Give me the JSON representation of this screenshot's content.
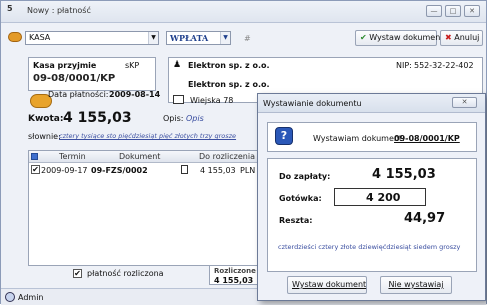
{
  "window": {
    "title": "Nowy : płatność",
    "app_glyph": "5",
    "controls": [
      "minimize-icon",
      "maximize-icon",
      "close-icon"
    ]
  },
  "toolbar": {
    "register_combo": "KASA",
    "type_combo": "WPŁATA",
    "hash": "#",
    "issue_document_label": "Wystaw dokument",
    "cancel_label": "Anuluj"
  },
  "receipt": {
    "kind_label": "Kasa przyjmie",
    "doc_type": "sKP",
    "number": "09-08/0001/KP",
    "payment_date_label": "Data płatności:",
    "payment_date": "2009-08-14",
    "amount_label": "Kwota:",
    "amount": "4 155,03",
    "in_words_label": "słownie:",
    "in_words": "cztery tysiące sto pięćdziesiąt pięć złotych trzy grosze",
    "description_label": "Opis:",
    "description": "Opis"
  },
  "contractor": {
    "name": "Elektron sp. z o.o.",
    "name2": "Elektron sp. z o.o.",
    "nip_label": "NIP:",
    "nip": "552-32-22-402",
    "street": "Wiejska 78"
  },
  "grid": {
    "columns": [
      "Termin",
      "Dokument",
      "Do rozliczenia"
    ],
    "rows": [
      {
        "checked": "✔",
        "termin": "2009-09-17",
        "dokument": "09-FZS/0002",
        "kwota": "4 155,03",
        "waluta": "PLN"
      }
    ],
    "footer_label": "Rozliczone",
    "footer_value": "4 155,03"
  },
  "settled_checkbox_label": "płatność rozliczona",
  "status_bar": {
    "user": "Admin"
  },
  "dialog": {
    "title": "Wystawianie dokumentu",
    "message_prefix": "Wystawiam dokument:",
    "document_number": "09-08/0001/KP",
    "to_pay_label": "Do zapłaty:",
    "to_pay": "4 155,03",
    "cash_label": "Gotówka:",
    "cash": "4 200",
    "change_label": "Reszta:",
    "change": "44,97",
    "change_in_words": "czterdzieści cztery złote dziewięćdziesiąt siedem groszy",
    "issue_button": "Wystaw dokument",
    "dont_issue_button": "Nie wystawiaj"
  }
}
